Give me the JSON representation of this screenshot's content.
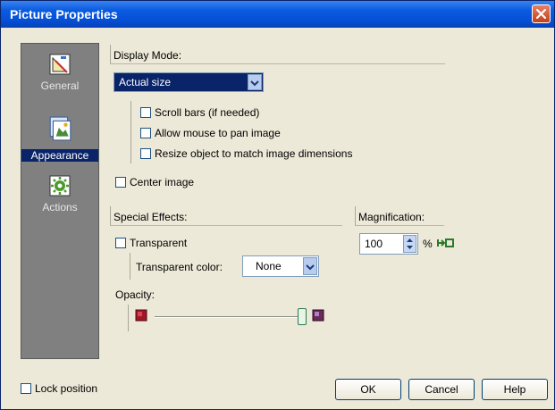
{
  "window": {
    "title": "Picture Properties"
  },
  "sidebar": {
    "items": [
      {
        "label": "General",
        "icon": "general-icon",
        "active": false
      },
      {
        "label": "Appearance",
        "icon": "appearance-icon",
        "active": true
      },
      {
        "label": "Actions",
        "icon": "actions-icon",
        "active": false
      }
    ]
  },
  "display_mode": {
    "label": "Display Mode:",
    "selected": "Actual size",
    "options": {
      "scroll_bars": {
        "label": "Scroll bars (if needed)",
        "checked": false
      },
      "allow_pan": {
        "label": "Allow mouse to pan image",
        "checked": false
      },
      "resize_object": {
        "label": "Resize object to match image dimensions",
        "checked": false
      }
    },
    "center_image": {
      "label": "Center image",
      "checked": false
    }
  },
  "special_effects": {
    "label": "Special Effects:",
    "transparent": {
      "label": "Transparent",
      "checked": false
    },
    "transparent_color": {
      "label": "Transparent color:",
      "value": "None"
    },
    "opacity": {
      "label": "Opacity:",
      "value_fraction": 1.0
    }
  },
  "magnification": {
    "label": "Magnification:",
    "value": "100",
    "unit": "%"
  },
  "footer": {
    "lock_position": {
      "label": "Lock position",
      "checked": false
    },
    "ok": "OK",
    "cancel": "Cancel",
    "help": "Help"
  },
  "colors": {
    "title_bar": "#0a5be0",
    "active_item": "#0a246a",
    "sidebar": "#808080",
    "dialog": "#ece9d8",
    "dropdown": "#0a246a"
  }
}
